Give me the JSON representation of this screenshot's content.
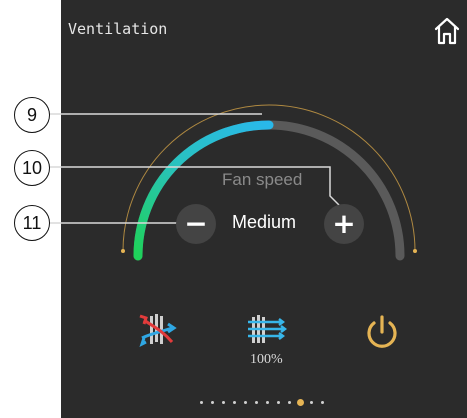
{
  "header": {
    "title": "Ventilation",
    "home_icon": "home-icon"
  },
  "fan": {
    "label": "Fan speed",
    "value": "Medium",
    "decrease_label": "−",
    "increase_label": "+"
  },
  "callouts": {
    "c9": "9",
    "c10": "10",
    "c11": "11"
  },
  "controls": {
    "mode_icon": "heat-recovery-icon",
    "flow_icon": "airflow-icon",
    "flow_percent": "100%",
    "power_icon": "power-icon"
  },
  "pager": {
    "count": 12,
    "active_index": 9
  },
  "colors": {
    "panel": "#2b2b2b",
    "accent": "#e5b454",
    "arc_start": "#1fd15a",
    "arc_end": "#29b8ea",
    "track": "#5a5a5a"
  }
}
